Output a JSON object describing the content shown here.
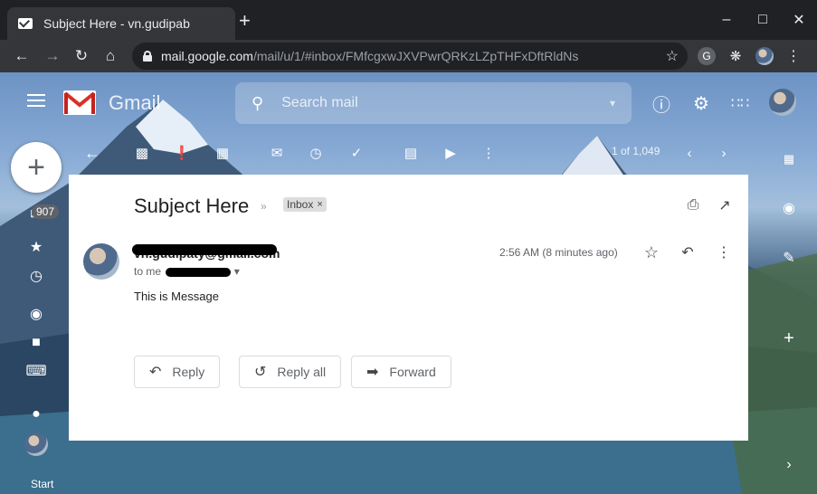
{
  "browser": {
    "tab_title": "Subject Here - vn.gudipab",
    "new_tab_label": "+",
    "url_host": "mail.google.com",
    "url_path": "/mail/u/1/#inbox/FMfcgxwJXVPwrQRKzLZpTHFxDftRldNs",
    "window_controls": {
      "minimize": "–",
      "maximize": "□",
      "close": "✕"
    },
    "icons": {
      "back": "arrow-left-icon",
      "forward": "arrow-right-icon",
      "reload": "reload-icon",
      "home": "home-icon",
      "bookmark": "star-icon",
      "extensions": "puzzle-icon"
    }
  },
  "gmail": {
    "app_name": "Gmail",
    "search_placeholder": "Search mail",
    "left_rail": {
      "compose_label": "+",
      "inbox_count": "907",
      "footer_text": "Start"
    },
    "toolbar": {
      "pager_text": "1 of 1,049"
    },
    "message": {
      "subject": "Subject Here",
      "label": "Inbox",
      "sender_email": "vn.gudipaty@gmail.com",
      "recipient_prefix": "to me",
      "timestamp": "2:56 AM (8 minutes ago)",
      "body": "This is Message",
      "actions": {
        "reply": "Reply",
        "reply_all": "Reply all",
        "forward": "Forward"
      }
    }
  }
}
